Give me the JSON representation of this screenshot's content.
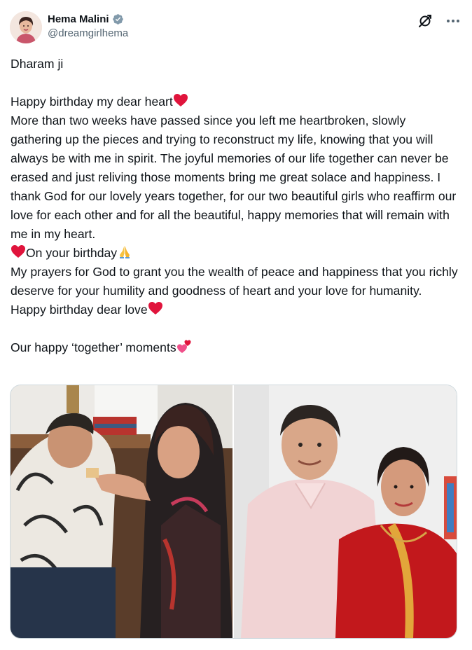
{
  "author": {
    "display_name": "Hema Malini",
    "handle": "@dreamgirlhema",
    "verified": true,
    "avatar_icon": "profile-photo"
  },
  "actions": {
    "grok_icon": "grok-icon",
    "more_icon": "more-horizontal-icon"
  },
  "post": {
    "line_salutation": "Dharam ji",
    "line_birthday": "Happy birthday my dear heart",
    "line_paragraph": "More than two weeks have passed since you left me heartbroken, slowly gathering up the pieces and trying to reconstruct my life, knowing that you will always be with me in spirit. The joyful memories of our life together can never be erased and just reliving those moments bring me great solace and happiness. I thank God for our lovely years together, for our two beautiful girls who reaffirm our love for each other and for all the beautiful, happy memories that will remain with me in my heart.",
    "line_on_birthday": "On your birthday",
    "line_prayers": "My prayers for God to grant you the wealth of peace and happiness that you richly deserve for your humility and goodness of heart and your love for humanity.",
    "line_dear_love": "Happy birthday dear love",
    "line_together": "Our happy ‘together’ moments",
    "emojis": [
      "red-heart",
      "red-heart",
      "folded-hands",
      "red-heart",
      "two-hearts"
    ]
  },
  "media": {
    "photos": [
      "photo-couple-seated-sweet",
      "photo-couple-standing-smiling"
    ]
  },
  "colors": {
    "verified_blue": "#1d9bf0",
    "heart_red": "#e0143c",
    "text_primary": "#0f1419",
    "text_secondary": "#536471"
  }
}
